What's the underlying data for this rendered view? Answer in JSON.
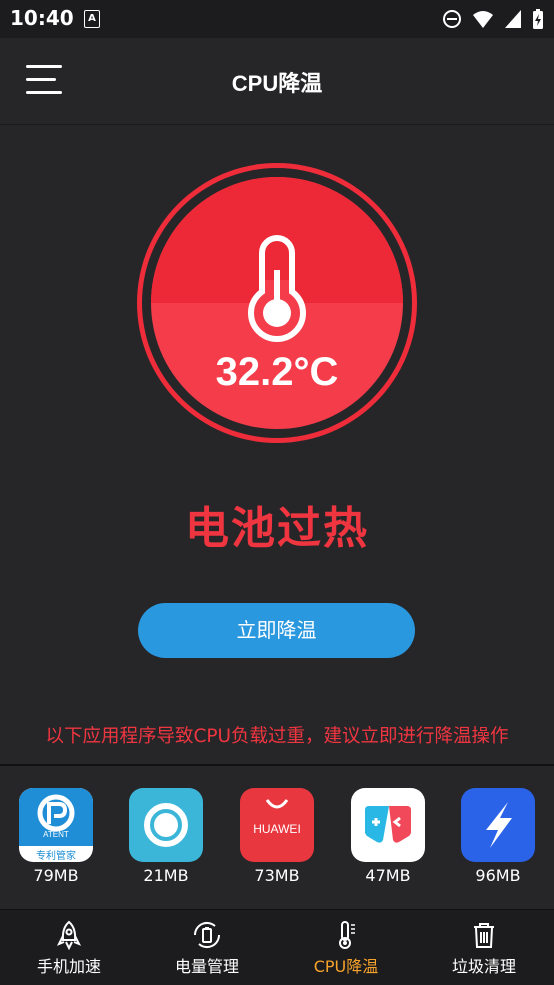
{
  "status_bar": {
    "time": "10:40",
    "notification_glyph": "A"
  },
  "header": {
    "title": "CPU降温",
    "menu_icon": "menu-icon"
  },
  "gauge": {
    "temperature": "32.2°C",
    "status": "电池过热"
  },
  "action": {
    "cool_button": "立即降温"
  },
  "warning": "以下应用程序导致CPU负载过重，建议立即进行降温操作",
  "apps": [
    {
      "size": "79MB",
      "icon": "patent-manager-icon",
      "icon_text": "ATENT",
      "icon_subtext": "专利管家"
    },
    {
      "size": "21MB",
      "icon": "circle-app-icon"
    },
    {
      "size": "73MB",
      "icon": "huawei-appgallery-icon",
      "icon_text": "HUAWEI"
    },
    {
      "size": "47MB",
      "icon": "game-center-icon"
    },
    {
      "size": "96MB",
      "icon": "lightning-app-icon"
    }
  ],
  "bottom_nav": {
    "items": [
      {
        "label": "手机加速",
        "icon": "rocket-icon"
      },
      {
        "label": "电量管理",
        "icon": "battery-cycle-icon"
      },
      {
        "label": "CPU降温",
        "icon": "thermometer-icon",
        "active": true
      },
      {
        "label": "垃圾清理",
        "icon": "trash-icon"
      }
    ]
  },
  "colors": {
    "accent_red": "#ef3540",
    "button_blue": "#2a98df",
    "active_tab": "#f7a22a",
    "background": "#262629"
  }
}
